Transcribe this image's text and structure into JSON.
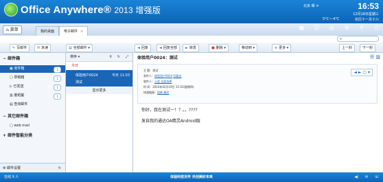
{
  "app": {
    "title": "Office Anywhere",
    "version": "2013 增强版",
    "logo_colors": [
      "#2e9a1e",
      "#9ff07a"
    ]
  },
  "clock": {
    "time": "16:53",
    "location": "北京",
    "weather": "晴",
    "date": "12月18日星期三",
    "temp": "5°C~-4°C",
    "lunar": "农历十一月十六"
  },
  "tabs": {
    "menu_label": "菜单",
    "items": [
      "我的桌面",
      "电子邮件"
    ]
  },
  "sys_icons": [
    "grid-icon",
    "users-icon",
    "support-icon",
    "gear-icon",
    "pin-icon",
    "power-icon"
  ],
  "toolbar": {
    "compose": "写邮件",
    "draft": "未读",
    "all_mail": "全部邮件",
    "reply": "回复",
    "reply_all": "回复全部",
    "forward": "转发",
    "delete": "删除",
    "move": "移动到",
    "more": "更多",
    "prev": "上一封",
    "next": "下一封"
  },
  "sidebar": {
    "sec_mail": "邮件箱",
    "items": [
      {
        "label": "收件箱",
        "count": "1"
      },
      {
        "label": "草稿箱",
        "count": "1"
      },
      {
        "label": "已发送",
        "count": "1"
      },
      {
        "label": "废纸篓",
        "count": "1"
      },
      {
        "label": "查询邮件",
        "count": ""
      }
    ],
    "sec_other": "其它邮件箱",
    "webmail": "web mail",
    "sec_smart": "邮件智能分类",
    "footer": "邮件设置"
  },
  "maillist": {
    "sort": "排序",
    "today": "今日",
    "from": "体验用户0024",
    "time": "今天 11:03",
    "subject": "测试",
    "more": "显示更多"
  },
  "reading": {
    "subject": "体验用户0024：测试",
    "meta": [
      {
        "label": "主 题：",
        "value": "测试"
      },
      {
        "label": "发件人：",
        "value": "体验用户0024",
        "extra": "回复名"
      },
      {
        "label": "收件人：",
        "value": "心会  全部选择"
      },
      {
        "label": "时 间：",
        "value": "2014年02月19日 11:03(星期四)"
      },
      {
        "label": "快速链接：",
        "value": "找邮  精灵"
      }
    ],
    "body1": "你好，我在测试一！？。。????",
    "body2": "发自我的通达OA精灵Android版"
  },
  "status": {
    "online": "在线 9 人",
    "slogan": "体验科技关怀 共创美好未来"
  }
}
